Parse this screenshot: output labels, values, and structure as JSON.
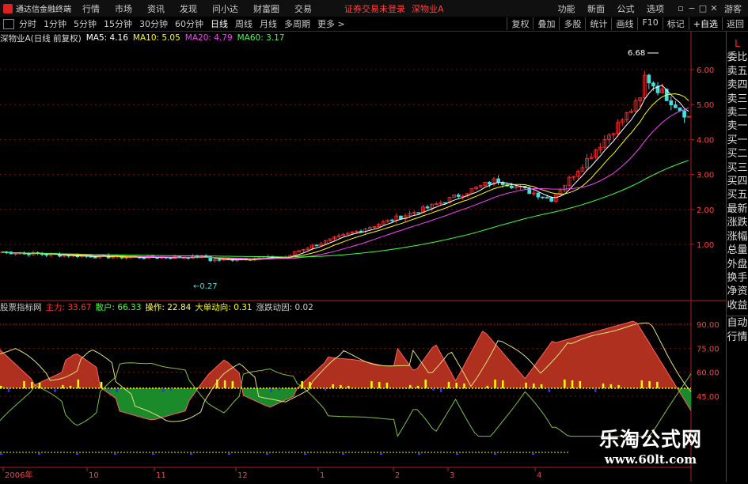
{
  "app": {
    "title": "通达信金融终端",
    "menu": [
      "行情",
      "市场",
      "资讯",
      "发现",
      "问小达",
      "财富圈",
      "交易"
    ],
    "broker_status": "证券交易未登录",
    "stock": "深物业A",
    "right_menu": [
      "功能",
      "新面",
      "公式",
      "选项"
    ],
    "user": "游客"
  },
  "periods": [
    "分时",
    "1分钟",
    "5分钟",
    "15分钟",
    "30分钟",
    "60分钟",
    "日线",
    "周线",
    "月线",
    "多周期",
    "更多 >"
  ],
  "active_period": "日线",
  "toolbar_right": [
    "复权",
    "叠加",
    "多股",
    "统计",
    "画线",
    "F10",
    "标记",
    "+自选",
    "返回"
  ],
  "main_legend": {
    "title": "深物业A(日线 前复权)",
    "ma5": "MA5: 4.16",
    "ma10": "MA10: 5.05",
    "ma20": "MA20: 4.79",
    "ma60": "MA60: 3.17"
  },
  "price_labels": {
    "high": "6.68",
    "low": "0.27"
  },
  "price_axis": [
    "6.00",
    "5.00",
    "4.00",
    "3.00",
    "2.00",
    "1.00"
  ],
  "indicator_axis": [
    "90.00",
    "75.00",
    "60.00",
    "45.00"
  ],
  "indicator_legend": {
    "name": "股票指标网",
    "main": "主力: 33.67",
    "retail": "散户: 66.33",
    "op": "操作: 22.84",
    "big": "大单动向: 0.31",
    "momentum": "涨跌动因: 0.02"
  },
  "date_axis": [
    "2006年",
    "10",
    "11",
    "12",
    "1",
    "2",
    "3",
    "4"
  ],
  "side_panel": {
    "mark": "L",
    "items": [
      "委比",
      "卖五",
      "卖四",
      "卖三",
      "卖二",
      "卖一",
      "买一",
      "买二",
      "买三",
      "买四",
      "买五",
      "最新",
      "涨跌",
      "涨幅",
      "总量",
      "外盘",
      "换手",
      "净资",
      "收益"
    ],
    "tabs": [
      "自动",
      "行情"
    ]
  },
  "watermark": {
    "cn": "乐淘公式网",
    "url": "www.60lt.com"
  },
  "colors": {
    "up": "#ff3030",
    "down": "#40e0e0",
    "ma5": "#ffffff",
    "ma10": "#ffff00",
    "ma20": "#ff40ff",
    "ma60": "#40ff40",
    "red_fill": "#b03020",
    "green_fill": "#1a8a2a"
  }
}
